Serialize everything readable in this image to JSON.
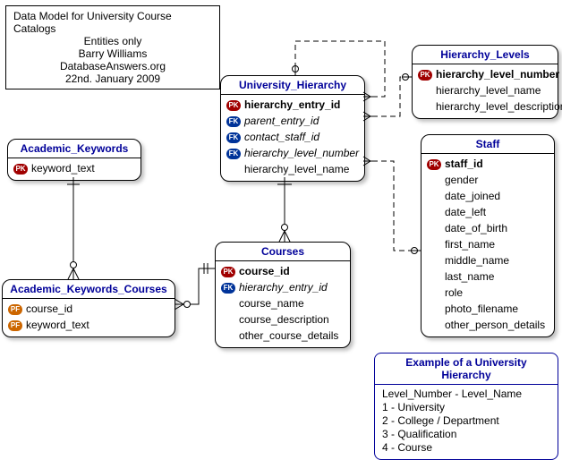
{
  "title_box": {
    "line1": "Data Model for University Course Catalogs",
    "line2": "Entities only",
    "line3": "Barry Williams",
    "line4": "DatabaseAnswers.org",
    "line5": "22nd. January 2009"
  },
  "entities": {
    "academic_keywords": {
      "name": "Academic_Keywords",
      "attrs": [
        {
          "icon": "pk",
          "text": "keyword_text"
        }
      ]
    },
    "academic_keywords_courses": {
      "name": "Academic_Keywords_Courses",
      "attrs": [
        {
          "icon": "pf",
          "text": "course_id"
        },
        {
          "icon": "pf",
          "text": "keyword_text"
        }
      ]
    },
    "university_hierarchy": {
      "name": "University_Hierarchy",
      "attrs": [
        {
          "icon": "pk",
          "text": "hierarchy_entry_id"
        },
        {
          "icon": "fk",
          "text": "parent_entry_id",
          "italic": true
        },
        {
          "icon": "fk",
          "text": "contact_staff_id",
          "italic": true
        },
        {
          "icon": "fk",
          "text": "hierarchy_level_number",
          "italic": true
        },
        {
          "icon": "",
          "text": "hierarchy_level_name"
        }
      ]
    },
    "courses": {
      "name": "Courses",
      "attrs": [
        {
          "icon": "pk",
          "text": "course_id"
        },
        {
          "icon": "fk",
          "text": "hierarchy_entry_id",
          "italic": true
        },
        {
          "icon": "",
          "text": "course_name"
        },
        {
          "icon": "",
          "text": "course_description"
        },
        {
          "icon": "",
          "text": "other_course_details"
        }
      ]
    },
    "hierarchy_levels": {
      "name": "Hierarchy_Levels",
      "attrs": [
        {
          "icon": "pk",
          "text": "hierarchy_level_number"
        },
        {
          "icon": "",
          "text": "hierarchy_level_name"
        },
        {
          "icon": "",
          "text": "hierarchy_level_description"
        }
      ]
    },
    "staff": {
      "name": "Staff",
      "attrs": [
        {
          "icon": "pk",
          "text": "staff_id"
        },
        {
          "icon": "",
          "text": "gender"
        },
        {
          "icon": "",
          "text": "date_joined"
        },
        {
          "icon": "",
          "text": "date_left"
        },
        {
          "icon": "",
          "text": "date_of_birth"
        },
        {
          "icon": "",
          "text": "first_name"
        },
        {
          "icon": "",
          "text": "middle_name"
        },
        {
          "icon": "",
          "text": "last_name"
        },
        {
          "icon": "",
          "text": "role"
        },
        {
          "icon": "",
          "text": "photo_filename"
        },
        {
          "icon": "",
          "text": "other_person_details"
        }
      ]
    }
  },
  "example": {
    "title": "Example of a University Hierarchy",
    "lines": [
      "Level_Number - Level_Name",
      "1 - University",
      "2 - College / Department",
      "3 - Qualification",
      "4 - Course"
    ]
  }
}
